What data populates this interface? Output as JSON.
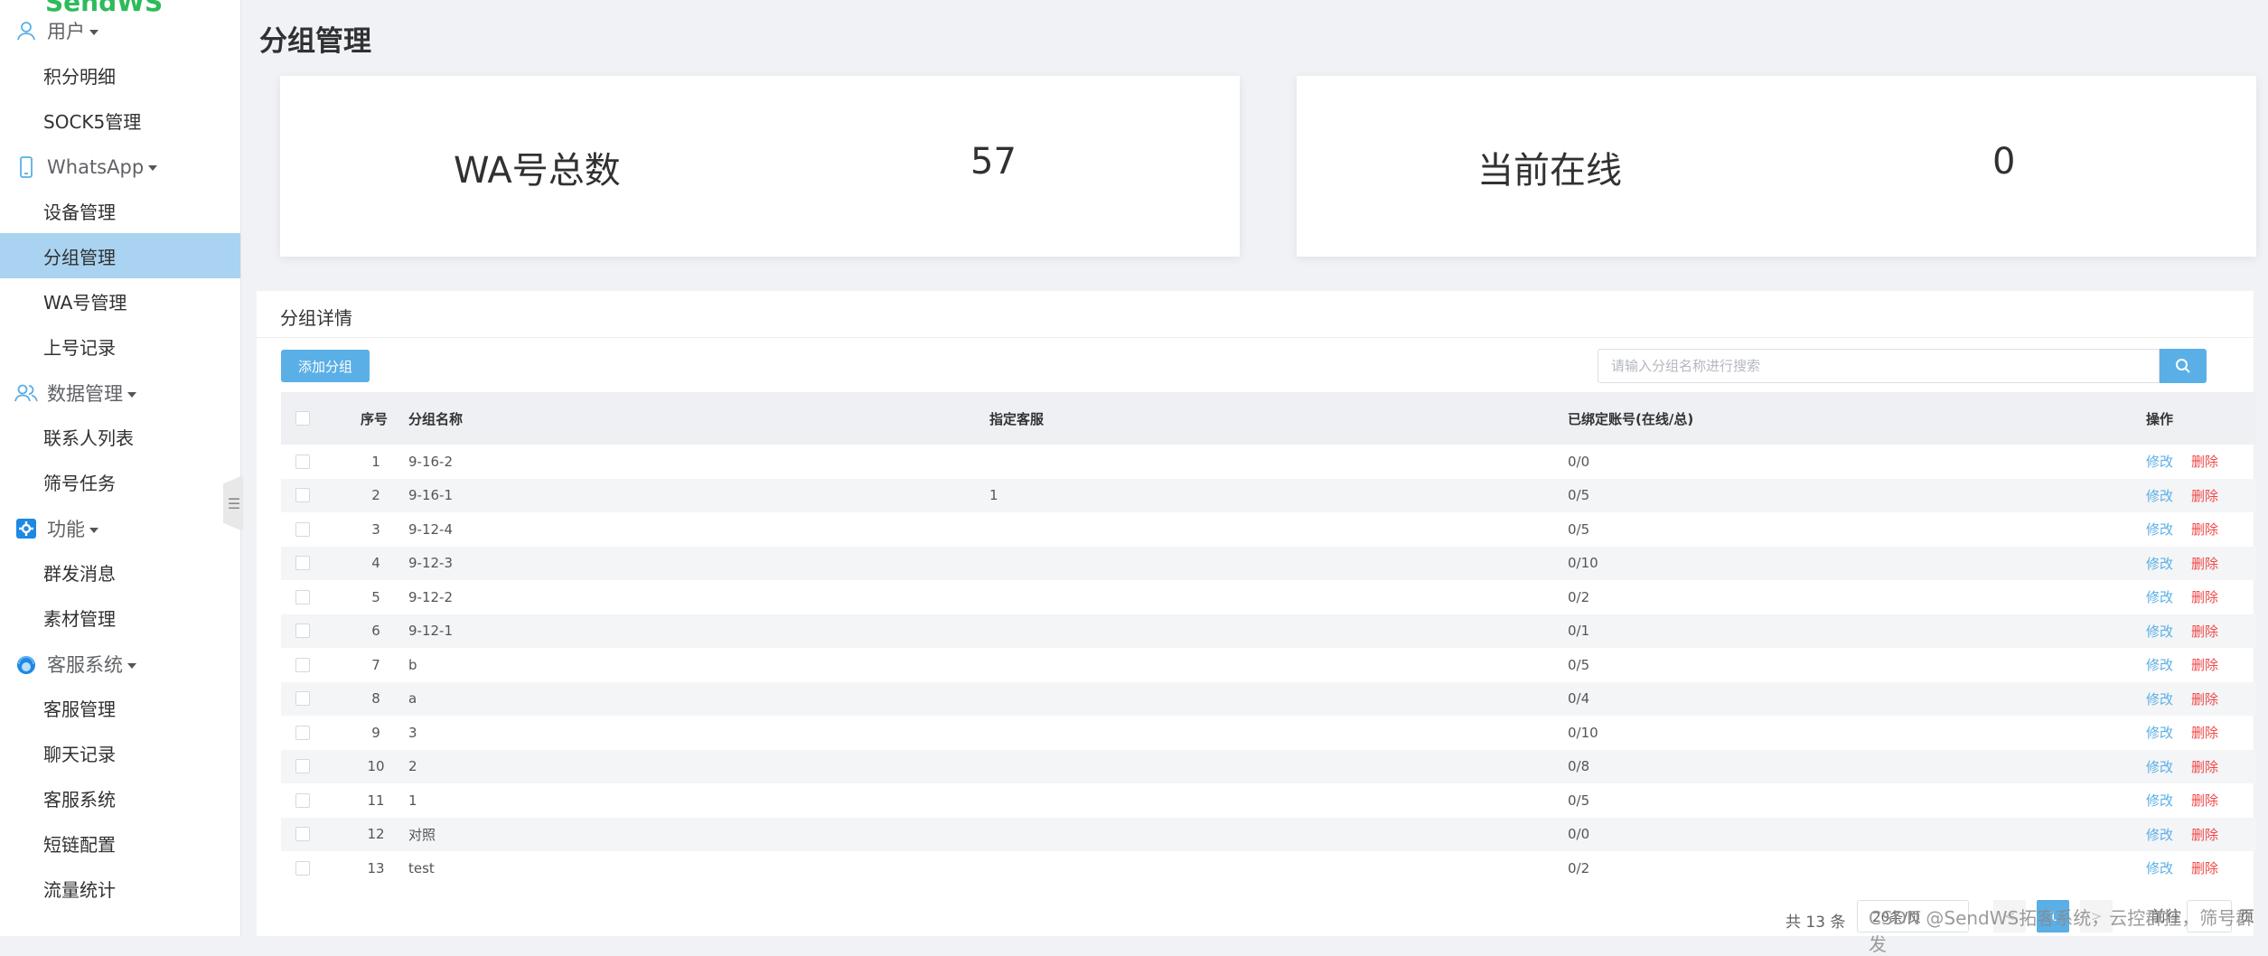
{
  "sidebar": {
    "logo_text": "SendWS",
    "groups": [
      {
        "label": "用户",
        "icon": "user-icon"
      },
      {
        "label": "WhatsApp",
        "icon": "phone-icon"
      },
      {
        "label": "数据管理",
        "icon": "users-icon"
      },
      {
        "label": "功能",
        "icon": "gear-icon"
      },
      {
        "label": "客服系统",
        "icon": "headset-icon"
      }
    ],
    "items": [
      "积分明细",
      "SOCK5管理",
      "设备管理",
      "分组管理",
      "WA号管理",
      "上号记录",
      "联系人列表",
      "筛号任务",
      "群发消息",
      "素材管理",
      "客服管理",
      "聊天记录",
      "客服系统",
      "短链配置",
      "流量统计"
    ],
    "active_item": "分组管理"
  },
  "page": {
    "title": "分组管理"
  },
  "stats": [
    {
      "label": "WA号总数",
      "value": "57"
    },
    {
      "label": "当前在线",
      "value": "0"
    }
  ],
  "panel": {
    "title": "分组详情",
    "add_button": "添加分组",
    "search_placeholder": "请输入分组名称进行搜索",
    "columns": [
      "序号",
      "分组名称",
      "指定客服",
      "已绑定账号(在线/总)",
      "操作"
    ],
    "edit_label": "修改",
    "delete_label": "删除",
    "rows": [
      {
        "no": "1",
        "name": "9-16-2",
        "agent": "",
        "bound": "0/0"
      },
      {
        "no": "2",
        "name": "9-16-1",
        "agent": "1",
        "bound": "0/5"
      },
      {
        "no": "3",
        "name": "9-12-4",
        "agent": "",
        "bound": "0/5"
      },
      {
        "no": "4",
        "name": "9-12-3",
        "agent": "",
        "bound": "0/10"
      },
      {
        "no": "5",
        "name": "9-12-2",
        "agent": "",
        "bound": "0/2"
      },
      {
        "no": "6",
        "name": "9-12-1",
        "agent": "",
        "bound": "0/1"
      },
      {
        "no": "7",
        "name": "b",
        "agent": "",
        "bound": "0/5"
      },
      {
        "no": "8",
        "name": "a",
        "agent": "",
        "bound": "0/4"
      },
      {
        "no": "9",
        "name": "3",
        "agent": "",
        "bound": "0/10"
      },
      {
        "no": "10",
        "name": "2",
        "agent": "",
        "bound": "0/8"
      },
      {
        "no": "11",
        "name": "1",
        "agent": "",
        "bound": "0/5"
      },
      {
        "no": "12",
        "name": "对照",
        "agent": "",
        "bound": "0/0"
      },
      {
        "no": "13",
        "name": "test",
        "agent": "",
        "bound": "0/2"
      }
    ]
  },
  "pagination": {
    "total": "共 13 条",
    "page_size": "20条/页",
    "prev": "<",
    "current_page": "1",
    "next": ">",
    "goto_prefix": "前往",
    "goto_suffix": "页"
  },
  "watermark": "CSDN @SendWS拓客系统，云控群控，筛号群发"
}
